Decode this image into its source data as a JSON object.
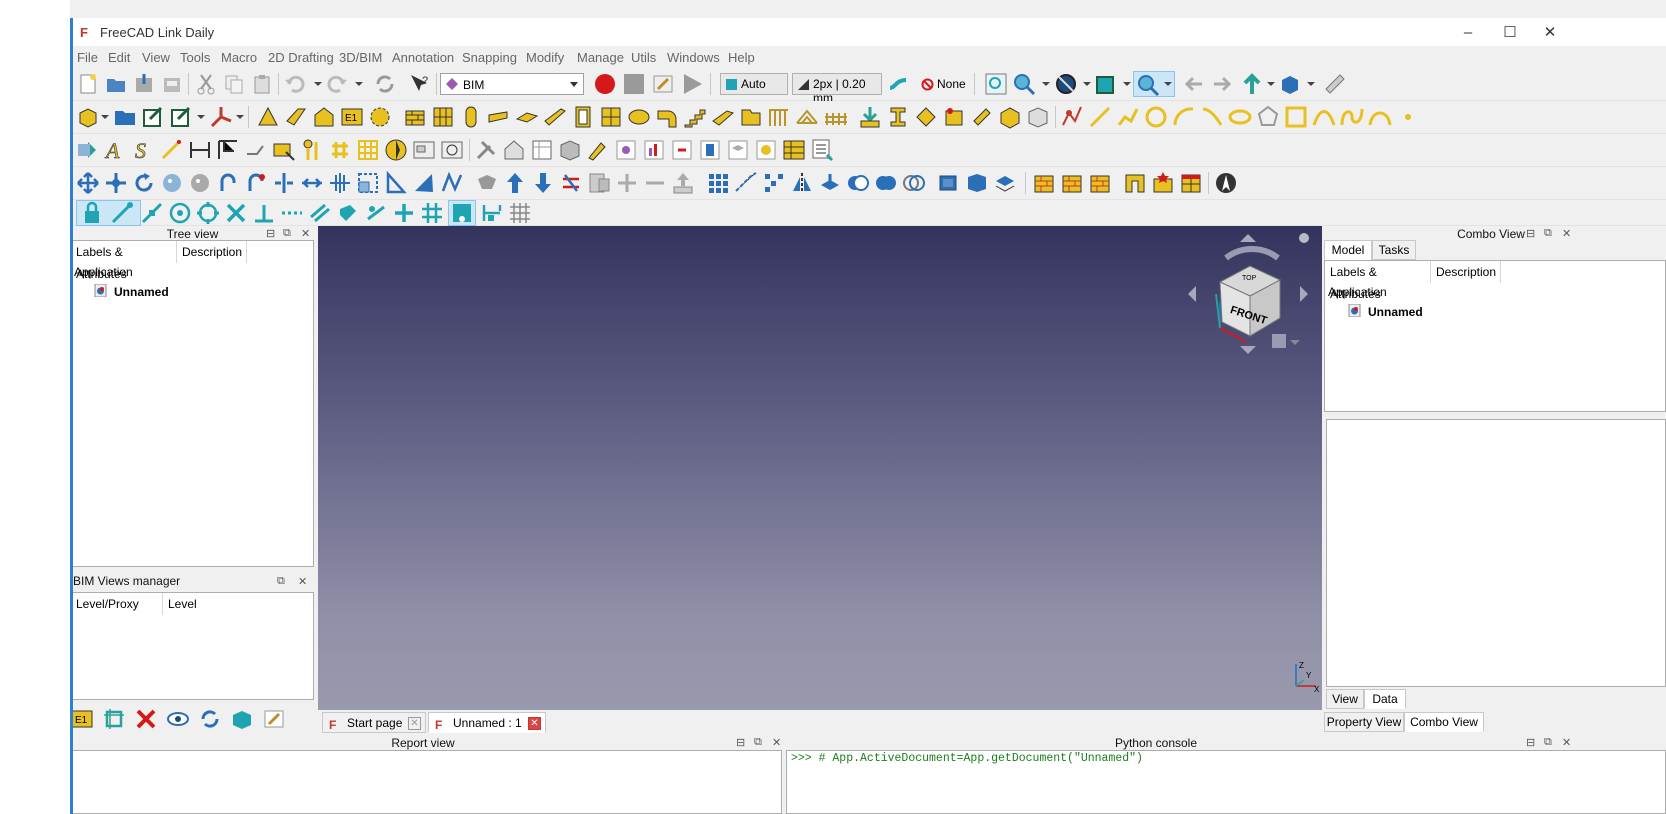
{
  "window": {
    "title": "FreeCAD Link Daily",
    "minimize": "–",
    "maximize": "☐",
    "close": "✕"
  },
  "menu": [
    "File",
    "Edit",
    "View",
    "Tools",
    "Macro",
    "2D Drafting",
    "3D/BIM",
    "Annotation",
    "Snapping",
    "Modify",
    "Manage",
    "Utils",
    "Windows",
    "Help"
  ],
  "toolbar": {
    "workbench": "BIM",
    "auto_label": "Auto",
    "line_style": "2px | 0.20 mm",
    "none_label": "None"
  },
  "tree_view": {
    "title": "Tree view",
    "col_labels": "Labels & Attributes",
    "col_description": "Description",
    "root": "Application",
    "document": "Unnamed"
  },
  "bim_views": {
    "title": "BIM Views manager",
    "col_level_proxy": "Level/Proxy",
    "col_level": "Level"
  },
  "combo_view": {
    "title": "Combo View",
    "tab_model": "Model",
    "tab_tasks": "Tasks",
    "col_labels": "Labels & Attributes",
    "col_description": "Description",
    "root": "Application",
    "document": "Unnamed",
    "prop_view_tab": "View",
    "prop_data_tab": "Data",
    "bottom_property_view": "Property View",
    "bottom_combo_view": "Combo View"
  },
  "doc_tabs": [
    "Start page",
    "Unnamed : 1"
  ],
  "report_view": {
    "title": "Report view"
  },
  "python_console": {
    "title": "Python console",
    "line": ">>> # App.ActiveDocument=App.getDocument(\"Unnamed\")"
  },
  "navcube": {
    "front": "FRONT",
    "top": "TOP"
  },
  "axis": {
    "x": "X",
    "y": "Y",
    "z": "Z"
  },
  "colors": {
    "accent_blue": "#2f7fd0",
    "bim_yellow": "#e8c020",
    "snap_teal": "#1fa4b4",
    "record_red": "#d41919"
  }
}
